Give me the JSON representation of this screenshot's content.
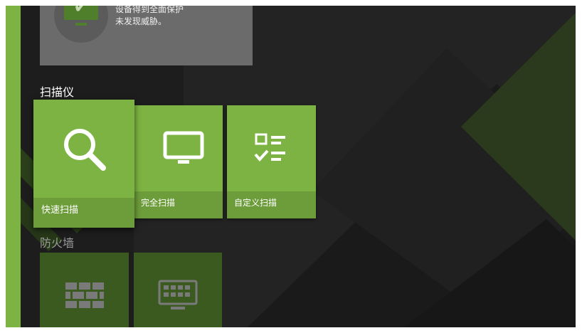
{
  "status": {
    "title": "设备得到全面保护",
    "subtitle": "未发现威胁。",
    "icon": "monitor-check-icon"
  },
  "scanner": {
    "section_title": "扫描仪",
    "quick_scan": {
      "label": "快速扫描",
      "icon": "search-icon"
    },
    "full_scan": {
      "label": "完全扫描",
      "icon": "monitor-icon"
    },
    "custom_scan": {
      "label": "自定义扫描",
      "icon": "checklist-icon"
    }
  },
  "firewall": {
    "section_title": "防火墙",
    "tiles": [
      {
        "icon": "brick-wall-icon"
      },
      {
        "icon": "keyboard-icon"
      }
    ]
  },
  "colors": {
    "accent": "#7cb342",
    "accent_footer": "#6d9c3a",
    "background": "#1d1d1d",
    "status_card": "#6b6b6b",
    "dim_tile": "#3a5a20"
  }
}
